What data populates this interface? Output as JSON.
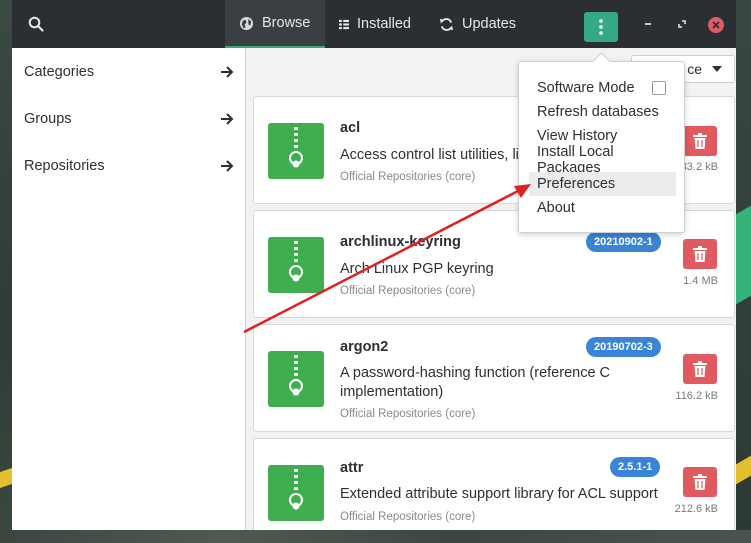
{
  "header": {
    "tabs": [
      {
        "label": "Browse",
        "icon": "globe-icon",
        "active": true
      },
      {
        "label": "Installed",
        "icon": "list-icon",
        "active": false
      },
      {
        "label": "Updates",
        "icon": "refresh-icon",
        "active": false
      }
    ],
    "accent": "#35a885"
  },
  "sidebar": {
    "items": [
      {
        "label": "Categories"
      },
      {
        "label": "Groups"
      },
      {
        "label": "Repositories"
      }
    ]
  },
  "sort": {
    "visible_text": "ce"
  },
  "packages": [
    {
      "name": "acl",
      "description": "Access control list utilities, libr",
      "repo": "Official Repositories (core)",
      "size": "33.2 kB"
    },
    {
      "name": "archlinux-keyring",
      "version": "20210902-1",
      "description": "Arch Linux PGP keyring",
      "repo": "Official Repositories (core)",
      "size": "1.4 MB"
    },
    {
      "name": "argon2",
      "version": "20190702-3",
      "description": "A password-hashing function (reference C implementation)",
      "repo": "Official Repositories (core)",
      "size": "116.2 kB"
    },
    {
      "name": "attr",
      "version": "2.5.1-1",
      "description": "Extended attribute support library for ACL support",
      "repo": "Official Repositories (core)",
      "size": "212.6 kB"
    }
  ],
  "menu": {
    "items": [
      {
        "label": "Software Mode",
        "checkbox": true,
        "checked": false
      },
      {
        "label": "Refresh databases"
      },
      {
        "label": "View History"
      },
      {
        "label": "Install Local Packages"
      },
      {
        "label": "Preferences",
        "highlighted": true
      },
      {
        "label": "About"
      }
    ]
  },
  "colors": {
    "header_bg": "#2b2f33",
    "badge": "#3a84d8",
    "remove": "#e05a5f",
    "package_icon": "#3fae4f",
    "annotation_arrow": "#e0201f"
  }
}
